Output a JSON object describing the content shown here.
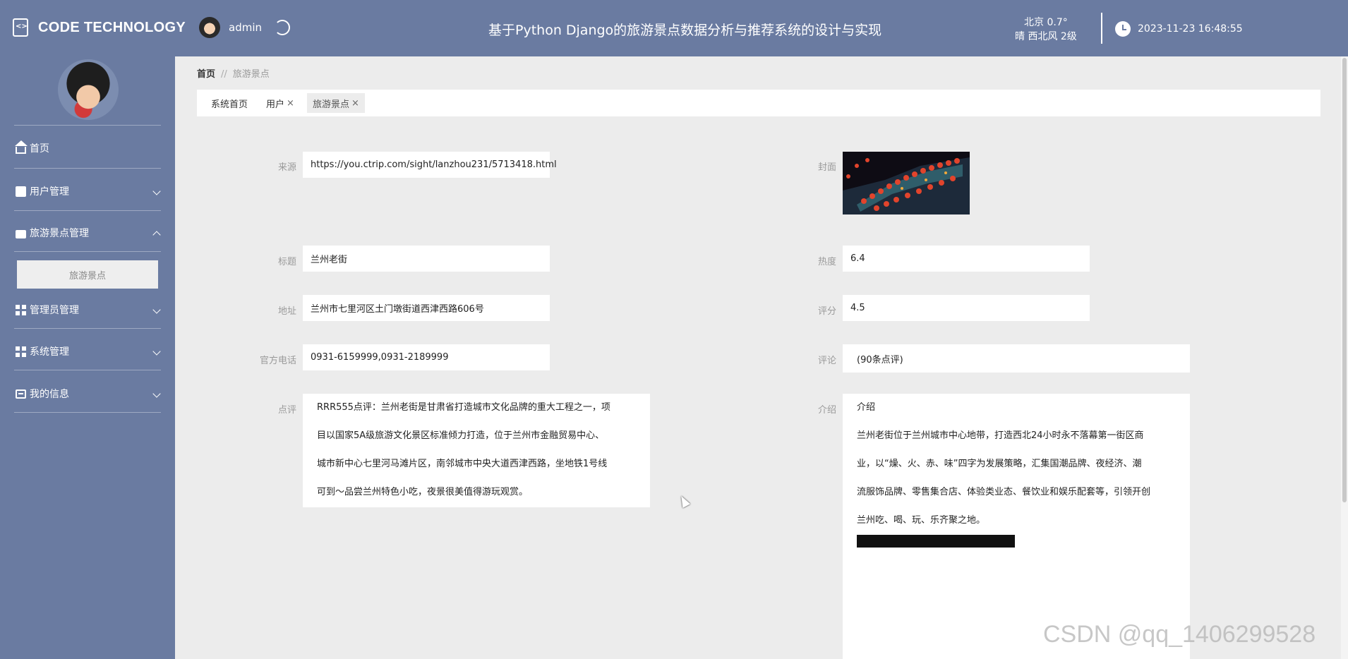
{
  "header": {
    "brand_name": "CODE TECHNOLOGY",
    "username": "admin",
    "system_title": "基于Python Django的旅游景点数据分析与推荐系统的设计与实现",
    "weather_line1": "北京  0.7°",
    "weather_line2": "晴  西北风  2级",
    "datetime": "2023-11-23 16:48:55"
  },
  "sidebar": {
    "items": [
      {
        "label": "首页",
        "icon": "home-icon"
      },
      {
        "label": "用户管理",
        "icon": "clipboard-icon"
      },
      {
        "label": "旅游景点管理",
        "icon": "briefcase-icon"
      },
      {
        "label": "管理员管理",
        "icon": "grid-icon"
      },
      {
        "label": "系统管理",
        "icon": "grid-icon"
      },
      {
        "label": "我的信息",
        "icon": "id-card-icon"
      }
    ],
    "active_sub_item": "旅游景点"
  },
  "breadcrumb": {
    "home": "首页",
    "separator": "//",
    "current": "旅游景点"
  },
  "tabs": [
    {
      "label": "系统首页",
      "closable": false
    },
    {
      "label": "用户",
      "closable": true
    },
    {
      "label": "旅游景点",
      "closable": true,
      "active": true
    }
  ],
  "tab_close_glyph": "×",
  "form": {
    "source": {
      "label": "来源",
      "value": "https://you.ctrip.com/sight/lanzhou231/5713418.html"
    },
    "cover": {
      "label": "封面"
    },
    "title": {
      "label": "标题",
      "value": "兰州老街"
    },
    "heat": {
      "label": "热度",
      "value": "6.4"
    },
    "address": {
      "label": "地址",
      "value": "兰州市七里河区土门墩街道西津西路606号"
    },
    "rating": {
      "label": "评分",
      "value": "4.5"
    },
    "phone": {
      "label": "官方电话",
      "value": "0931-6159999,0931-2189999"
    },
    "comments": {
      "label": "评论",
      "value": "(90条点评)"
    },
    "review": {
      "label": "点评",
      "lines": [
        "RRR555点评：兰州老街是甘肃省打造城市文化品牌的重大工程之一，项",
        "目以国家5A级旅游文化景区标准倾力打造，位于兰州市金融贸易中心、",
        "城市新中心七里河马滩片区，南邻城市中央大道西津西路，坐地铁1号线",
        "可到～品尝兰州特色小吃，夜景很美值得游玩观赏。"
      ]
    },
    "intro": {
      "label": "介绍",
      "heading": "介绍",
      "lines": [
        "兰州老街位于兰州城市中心地带，打造西北24小时永不落幕第一街区商",
        "业，以“燥、火、赤、味”四字为发展策略，汇集国潮品牌、夜经济、潮",
        "流服饰品牌、零售集合店、体验类业态、餐饮业和娱乐配套等，引领开创",
        "兰州吃、喝、玩、乐齐聚之地。"
      ]
    }
  },
  "watermark": "CSDN @qq_1406299528",
  "colors": {
    "header_bg": "#6a7ba1",
    "sidebar_bg": "#6a7ba1",
    "page_bg": "#ececec"
  }
}
